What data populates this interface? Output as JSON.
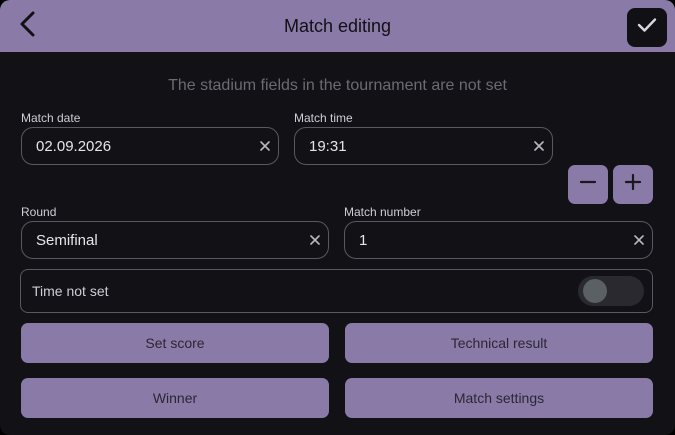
{
  "header": {
    "title": "Match editing",
    "back_icon": "chevron-left-icon",
    "confirm_icon": "checkmark-icon"
  },
  "notice": "The stadium fields in the tournament are not set",
  "fields": {
    "match_date": {
      "label": "Match date",
      "value": "02.09.2026"
    },
    "match_time": {
      "label": "Match time",
      "value": "19:31"
    },
    "round": {
      "label": "Round",
      "value": "Semifinal"
    },
    "match_number": {
      "label": "Match number",
      "value": "1"
    }
  },
  "stepper": {
    "minus_icon": "minus-icon",
    "plus_icon": "plus-icon"
  },
  "time_toggle": {
    "label": "Time not set",
    "checked": false
  },
  "actions": {
    "set_score": "Set score",
    "technical_result": "Technical result",
    "winner": "Winner",
    "match_settings": "Match settings"
  },
  "colors": {
    "accent": "#8a7aa8",
    "background": "#121115",
    "border": "#5a5860",
    "muted_text": "#6c6a72"
  }
}
